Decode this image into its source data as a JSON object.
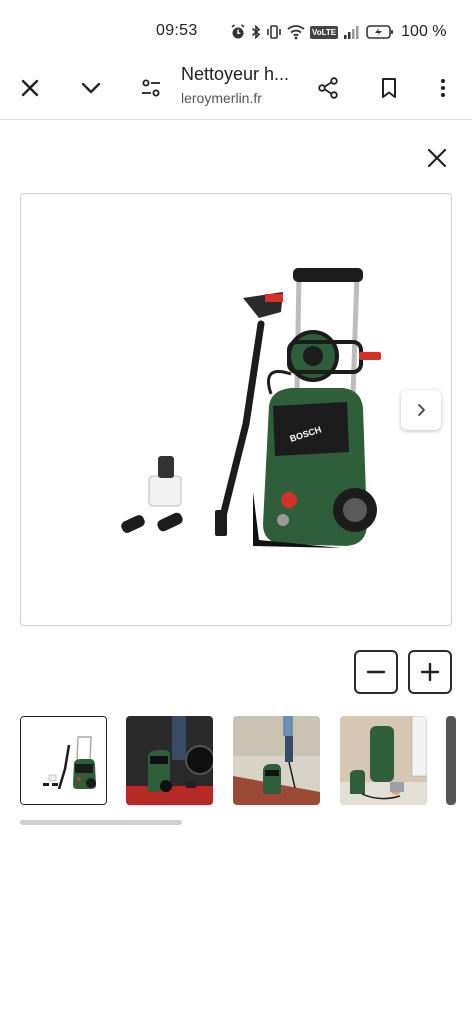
{
  "status_bar": {
    "time": "09:53",
    "battery": "100 %",
    "volte_label": "VoLTE"
  },
  "toolbar": {
    "title": "Nettoyeur h...",
    "domain": "leroymerlin.fr"
  },
  "viewer": {
    "zoom_out_label": "−",
    "zoom_in_label": "+",
    "thumbnails": [
      {
        "label": "product-studio",
        "active": true
      },
      {
        "label": "garage-scene",
        "active": false
      },
      {
        "label": "patio-scene",
        "active": false
      },
      {
        "label": "garden-scene",
        "active": false
      }
    ]
  },
  "colors": {
    "bosch_green": "#2f5e3a",
    "accent_red": "#d6302a",
    "dark": "#1b1b1b"
  }
}
